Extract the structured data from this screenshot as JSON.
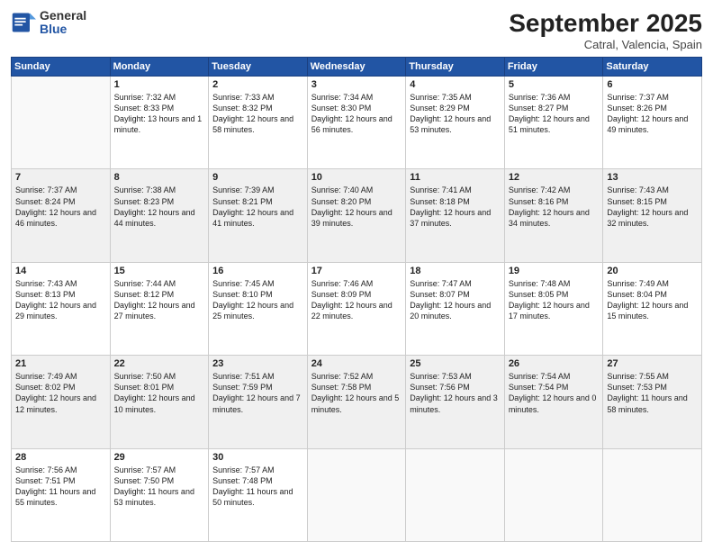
{
  "header": {
    "logo_line1": "General",
    "logo_line2": "Blue",
    "month": "September 2025",
    "location": "Catral, Valencia, Spain"
  },
  "days_of_week": [
    "Sunday",
    "Monday",
    "Tuesday",
    "Wednesday",
    "Thursday",
    "Friday",
    "Saturday"
  ],
  "weeks": [
    [
      {
        "day": "",
        "empty": true
      },
      {
        "day": "1",
        "sunrise": "Sunrise: 7:32 AM",
        "sunset": "Sunset: 8:33 PM",
        "daylight": "Daylight: 13 hours and 1 minute."
      },
      {
        "day": "2",
        "sunrise": "Sunrise: 7:33 AM",
        "sunset": "Sunset: 8:32 PM",
        "daylight": "Daylight: 12 hours and 58 minutes."
      },
      {
        "day": "3",
        "sunrise": "Sunrise: 7:34 AM",
        "sunset": "Sunset: 8:30 PM",
        "daylight": "Daylight: 12 hours and 56 minutes."
      },
      {
        "day": "4",
        "sunrise": "Sunrise: 7:35 AM",
        "sunset": "Sunset: 8:29 PM",
        "daylight": "Daylight: 12 hours and 53 minutes."
      },
      {
        "day": "5",
        "sunrise": "Sunrise: 7:36 AM",
        "sunset": "Sunset: 8:27 PM",
        "daylight": "Daylight: 12 hours and 51 minutes."
      },
      {
        "day": "6",
        "sunrise": "Sunrise: 7:37 AM",
        "sunset": "Sunset: 8:26 PM",
        "daylight": "Daylight: 12 hours and 49 minutes."
      }
    ],
    [
      {
        "day": "7",
        "sunrise": "Sunrise: 7:37 AM",
        "sunset": "Sunset: 8:24 PM",
        "daylight": "Daylight: 12 hours and 46 minutes."
      },
      {
        "day": "8",
        "sunrise": "Sunrise: 7:38 AM",
        "sunset": "Sunset: 8:23 PM",
        "daylight": "Daylight: 12 hours and 44 minutes."
      },
      {
        "day": "9",
        "sunrise": "Sunrise: 7:39 AM",
        "sunset": "Sunset: 8:21 PM",
        "daylight": "Daylight: 12 hours and 41 minutes."
      },
      {
        "day": "10",
        "sunrise": "Sunrise: 7:40 AM",
        "sunset": "Sunset: 8:20 PM",
        "daylight": "Daylight: 12 hours and 39 minutes."
      },
      {
        "day": "11",
        "sunrise": "Sunrise: 7:41 AM",
        "sunset": "Sunset: 8:18 PM",
        "daylight": "Daylight: 12 hours and 37 minutes."
      },
      {
        "day": "12",
        "sunrise": "Sunrise: 7:42 AM",
        "sunset": "Sunset: 8:16 PM",
        "daylight": "Daylight: 12 hours and 34 minutes."
      },
      {
        "day": "13",
        "sunrise": "Sunrise: 7:43 AM",
        "sunset": "Sunset: 8:15 PM",
        "daylight": "Daylight: 12 hours and 32 minutes."
      }
    ],
    [
      {
        "day": "14",
        "sunrise": "Sunrise: 7:43 AM",
        "sunset": "Sunset: 8:13 PM",
        "daylight": "Daylight: 12 hours and 29 minutes."
      },
      {
        "day": "15",
        "sunrise": "Sunrise: 7:44 AM",
        "sunset": "Sunset: 8:12 PM",
        "daylight": "Daylight: 12 hours and 27 minutes."
      },
      {
        "day": "16",
        "sunrise": "Sunrise: 7:45 AM",
        "sunset": "Sunset: 8:10 PM",
        "daylight": "Daylight: 12 hours and 25 minutes."
      },
      {
        "day": "17",
        "sunrise": "Sunrise: 7:46 AM",
        "sunset": "Sunset: 8:09 PM",
        "daylight": "Daylight: 12 hours and 22 minutes."
      },
      {
        "day": "18",
        "sunrise": "Sunrise: 7:47 AM",
        "sunset": "Sunset: 8:07 PM",
        "daylight": "Daylight: 12 hours and 20 minutes."
      },
      {
        "day": "19",
        "sunrise": "Sunrise: 7:48 AM",
        "sunset": "Sunset: 8:05 PM",
        "daylight": "Daylight: 12 hours and 17 minutes."
      },
      {
        "day": "20",
        "sunrise": "Sunrise: 7:49 AM",
        "sunset": "Sunset: 8:04 PM",
        "daylight": "Daylight: 12 hours and 15 minutes."
      }
    ],
    [
      {
        "day": "21",
        "sunrise": "Sunrise: 7:49 AM",
        "sunset": "Sunset: 8:02 PM",
        "daylight": "Daylight: 12 hours and 12 minutes."
      },
      {
        "day": "22",
        "sunrise": "Sunrise: 7:50 AM",
        "sunset": "Sunset: 8:01 PM",
        "daylight": "Daylight: 12 hours and 10 minutes."
      },
      {
        "day": "23",
        "sunrise": "Sunrise: 7:51 AM",
        "sunset": "Sunset: 7:59 PM",
        "daylight": "Daylight: 12 hours and 7 minutes."
      },
      {
        "day": "24",
        "sunrise": "Sunrise: 7:52 AM",
        "sunset": "Sunset: 7:58 PM",
        "daylight": "Daylight: 12 hours and 5 minutes."
      },
      {
        "day": "25",
        "sunrise": "Sunrise: 7:53 AM",
        "sunset": "Sunset: 7:56 PM",
        "daylight": "Daylight: 12 hours and 3 minutes."
      },
      {
        "day": "26",
        "sunrise": "Sunrise: 7:54 AM",
        "sunset": "Sunset: 7:54 PM",
        "daylight": "Daylight: 12 hours and 0 minutes."
      },
      {
        "day": "27",
        "sunrise": "Sunrise: 7:55 AM",
        "sunset": "Sunset: 7:53 PM",
        "daylight": "Daylight: 11 hours and 58 minutes."
      }
    ],
    [
      {
        "day": "28",
        "sunrise": "Sunrise: 7:56 AM",
        "sunset": "Sunset: 7:51 PM",
        "daylight": "Daylight: 11 hours and 55 minutes."
      },
      {
        "day": "29",
        "sunrise": "Sunrise: 7:57 AM",
        "sunset": "Sunset: 7:50 PM",
        "daylight": "Daylight: 11 hours and 53 minutes."
      },
      {
        "day": "30",
        "sunrise": "Sunrise: 7:57 AM",
        "sunset": "Sunset: 7:48 PM",
        "daylight": "Daylight: 11 hours and 50 minutes."
      },
      {
        "day": "",
        "empty": true
      },
      {
        "day": "",
        "empty": true
      },
      {
        "day": "",
        "empty": true
      },
      {
        "day": "",
        "empty": true
      }
    ]
  ]
}
